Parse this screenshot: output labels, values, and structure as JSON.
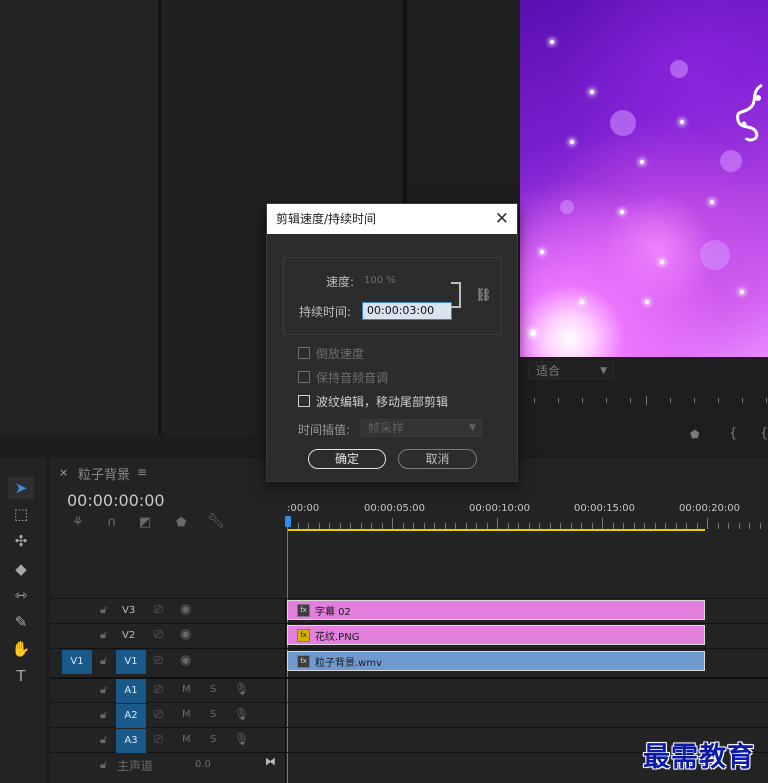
{
  "dialog": {
    "title": "剪辑速度/持续时间",
    "speed_label": "速度:",
    "speed_value": "100 %",
    "duration_label": "持续时间:",
    "duration_value": "00:00:03:00",
    "reverse_label": "倒放速度",
    "maintain_pitch_label": "保持音频音调",
    "ripple_label": "波纹编辑，移动尾部剪辑",
    "interp_label": "时间插值:",
    "interp_value": "帧采样",
    "ok_label": "确定",
    "cancel_label": "取消"
  },
  "program_monitor": {
    "fit_value": "适合"
  },
  "timeline": {
    "sequence_name": "粒子背景",
    "timecode": "00:00:00:00",
    "ruler": [
      ":00:00",
      "00:00:05:00",
      "00:00:10:00",
      "00:00:15:00",
      "00:00:20:00"
    ],
    "tracks_video": [
      {
        "name": "V3",
        "clip": "字幕 02",
        "color": "#e27fdf"
      },
      {
        "name": "V2",
        "clip": "花纹.PNG",
        "color": "#e27fdf"
      },
      {
        "name": "V1",
        "source": "V1",
        "clip": "粒子背景.wmv",
        "color": "#6f9ad0"
      }
    ],
    "tracks_audio": [
      {
        "name": "A1",
        "m": "M",
        "s": "S"
      },
      {
        "name": "A2",
        "m": "M",
        "s": "S"
      },
      {
        "name": "A3",
        "m": "M",
        "s": "S"
      }
    ],
    "master": {
      "label": "主声道",
      "value": "0.0"
    }
  },
  "watermark": "最需教育",
  "colors": {
    "accent": "#1a5a8a",
    "playhead": "#2d8ceb",
    "workarea": "#e6d200"
  }
}
